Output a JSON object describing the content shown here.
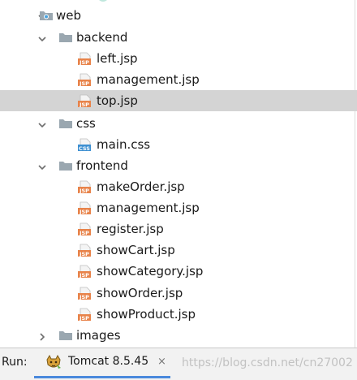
{
  "tree": {
    "nodes": [
      {
        "label": "web",
        "icon": "web-module-folder-icon",
        "expander": "chevron-down-icon"
      },
      {
        "label": "backend",
        "icon": "folder-icon",
        "expander": "chevron-down-icon"
      },
      {
        "label": "left.jsp",
        "icon": "jsp-file-icon",
        "badge": "JSP"
      },
      {
        "label": "management.jsp",
        "icon": "jsp-file-icon",
        "badge": "JSP"
      },
      {
        "label": "top.jsp",
        "icon": "jsp-file-icon",
        "badge": "JSP",
        "selected": true
      },
      {
        "label": "css",
        "icon": "folder-icon",
        "expander": "chevron-down-icon"
      },
      {
        "label": "main.css",
        "icon": "css-file-icon",
        "badge": "CSS"
      },
      {
        "label": "frontend",
        "icon": "folder-icon",
        "expander": "chevron-down-icon"
      },
      {
        "label": "makeOrder.jsp",
        "icon": "jsp-file-icon",
        "badge": "JSP"
      },
      {
        "label": "management.jsp",
        "icon": "jsp-file-icon",
        "badge": "JSP"
      },
      {
        "label": "register.jsp",
        "icon": "jsp-file-icon",
        "badge": "JSP"
      },
      {
        "label": "showCart.jsp",
        "icon": "jsp-file-icon",
        "badge": "JSP"
      },
      {
        "label": "showCategory.jsp",
        "icon": "jsp-file-icon",
        "badge": "JSP"
      },
      {
        "label": "showOrder.jsp",
        "icon": "jsp-file-icon",
        "badge": "JSP"
      },
      {
        "label": "showProduct.jsp",
        "icon": "jsp-file-icon",
        "badge": "JSP"
      },
      {
        "label": "images",
        "icon": "folder-icon",
        "expander": "chevron-right-icon"
      }
    ]
  },
  "run_bar": {
    "label": "Run:",
    "tab_label": "Tomcat 8.5.45",
    "tab_icon": "tomcat-icon",
    "close_glyph": "×",
    "watermark": "https://blog.csdn.net/cn27002"
  },
  "colors": {
    "selection": "#d4d4d4",
    "folder": "#9aa7b0",
    "jsp_badge": "#e8834a",
    "css_badge": "#3d8fd1",
    "web_module_dot": "#4aa3df",
    "active_tab_underline": "#4a89dc"
  }
}
